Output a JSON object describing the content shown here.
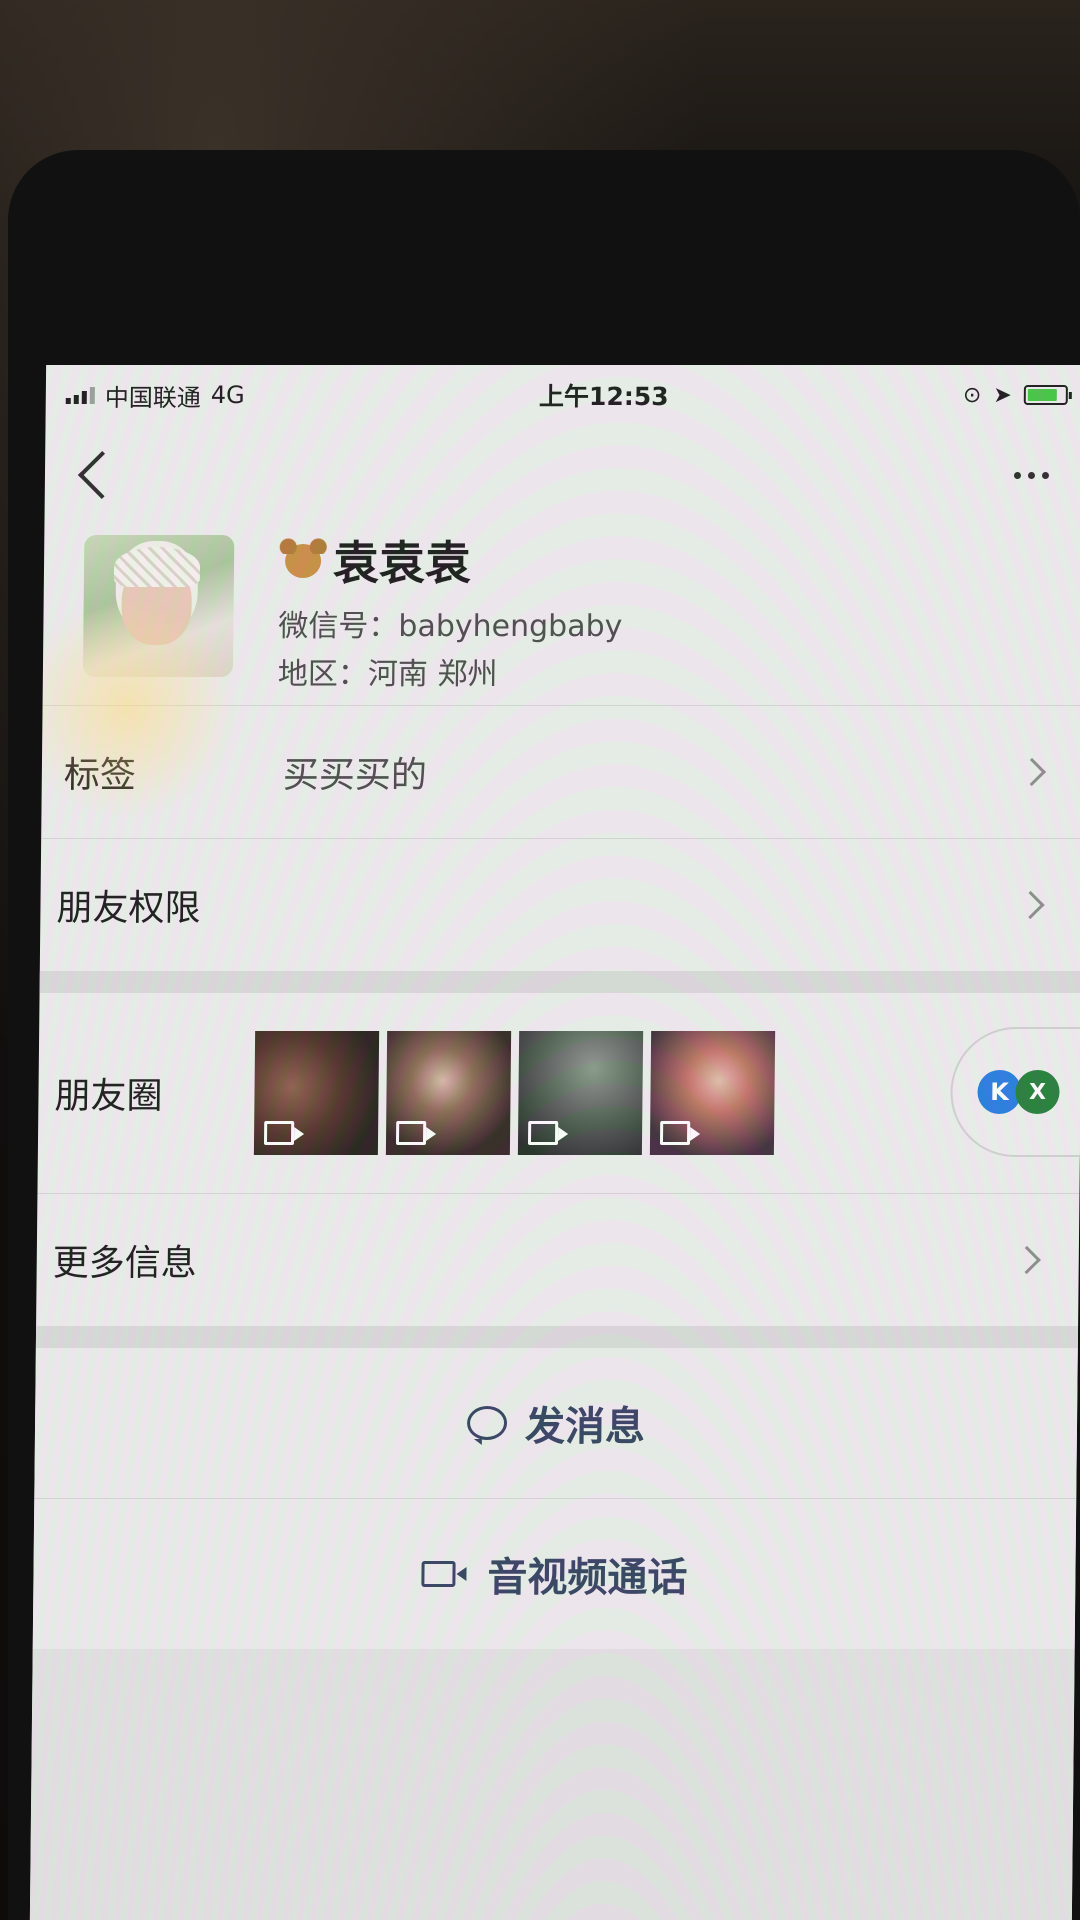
{
  "status": {
    "carrier": "中国联通",
    "network": "4G",
    "time": "上午12:53"
  },
  "profile": {
    "name": "袁袁袁",
    "wechat_id_label": "微信号：",
    "wechat_id": "babyhengbaby",
    "region_label": "地区：",
    "region": "河南 郑州"
  },
  "rows": {
    "tags_label": "标签",
    "tags_value": "买买买的",
    "permissions_label": "朋友权限",
    "moments_label": "朋友圈",
    "more_label": "更多信息"
  },
  "floating_badge": {
    "k_text": "K",
    "x_text": "X"
  },
  "actions": {
    "message_label": "发消息",
    "call_label": "音视频通话"
  },
  "icons": [
    "back-icon",
    "more-icon",
    "bear-icon",
    "chevron-right-icon",
    "video-icon",
    "chat-icon"
  ]
}
